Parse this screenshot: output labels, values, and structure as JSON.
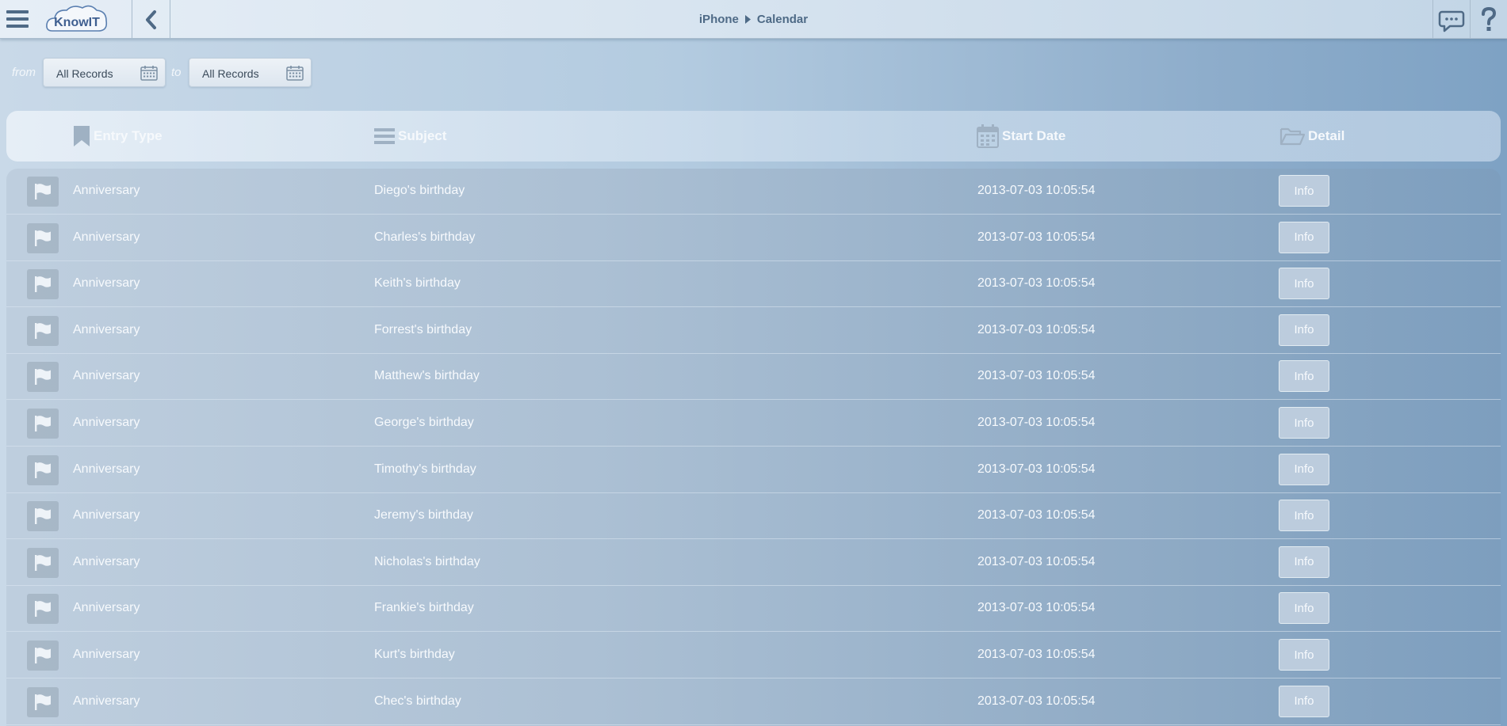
{
  "header": {
    "logo_text": "KnowIT",
    "breadcrumb": [
      "iPhone",
      "Calendar"
    ]
  },
  "filter": {
    "from_label": "from",
    "to_label": "to",
    "from_value": "All Records",
    "to_value": "All Records"
  },
  "table": {
    "columns": {
      "entry_type": "Entry Type",
      "subject": "Subject",
      "start_date": "Start Date",
      "detail": "Detail"
    },
    "rows": [
      {
        "type": "Anniversary",
        "subject": "Diego's birthday",
        "date": "2013-07-03 10:05:54",
        "action": "Info"
      },
      {
        "type": "Anniversary",
        "subject": "Charles's birthday",
        "date": "2013-07-03 10:05:54",
        "action": "Info"
      },
      {
        "type": "Anniversary",
        "subject": "Keith's birthday",
        "date": "2013-07-03 10:05:54",
        "action": "Info"
      },
      {
        "type": "Anniversary",
        "subject": "Forrest's birthday",
        "date": "2013-07-03 10:05:54",
        "action": "Info"
      },
      {
        "type": "Anniversary",
        "subject": "Matthew's birthday",
        "date": "2013-07-03 10:05:54",
        "action": "Info"
      },
      {
        "type": "Anniversary",
        "subject": "George's birthday",
        "date": "2013-07-03 10:05:54",
        "action": "Info"
      },
      {
        "type": "Anniversary",
        "subject": "Timothy's birthday",
        "date": "2013-07-03 10:05:54",
        "action": "Info"
      },
      {
        "type": "Anniversary",
        "subject": "Jeremy's birthday",
        "date": "2013-07-03 10:05:54",
        "action": "Info"
      },
      {
        "type": "Anniversary",
        "subject": "Nicholas's birthday",
        "date": "2013-07-03 10:05:54",
        "action": "Info"
      },
      {
        "type": "Anniversary",
        "subject": "Frankie's birthday",
        "date": "2013-07-03 10:05:54",
        "action": "Info"
      },
      {
        "type": "Anniversary",
        "subject": "Kurt's birthday",
        "date": "2013-07-03 10:05:54",
        "action": "Info"
      },
      {
        "type": "Anniversary",
        "subject": "Chec's birthday",
        "date": "2013-07-03 10:05:54",
        "action": "Info"
      }
    ]
  },
  "icons": {
    "menu": "hamburger-icon",
    "back": "chevron-left-icon",
    "breadcrumb_separator": "caret-right-icon",
    "chat": "chat-bubble-icon",
    "help": "question-mark-icon",
    "calendar": "calendar-icon",
    "entry_type": "bookmark-icon",
    "subject": "list-lines-icon",
    "start_date": "calendar-icon",
    "detail": "folder-open-icon",
    "row_type": "flag-icon"
  },
  "colors": {
    "brand_text": "#3f5f90",
    "breadcrumb_text": "#4e6a86",
    "row_text": "#f7fafd"
  }
}
